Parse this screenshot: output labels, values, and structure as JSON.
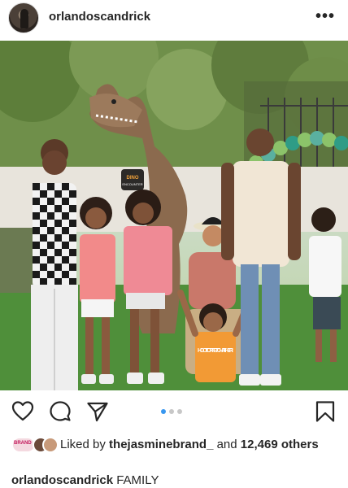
{
  "post": {
    "username": "orlandoscandrick",
    "more_icon": "ellipsis-icon",
    "photo_alt": "",
    "sign_text_1": "DINO",
    "sign_text_2": "ENCOUNTER",
    "shirt_text": "HOOT OR FETCH ATHER!"
  },
  "actions": {
    "like_icon": "heart-icon",
    "comment_icon": "comment-icon",
    "share_icon": "paper-plane-icon",
    "save_icon": "bookmark-icon"
  },
  "carousel": {
    "total": 3,
    "active": 1
  },
  "likes": {
    "prefix": "Liked by",
    "user": "thejasminebrand_",
    "connector": "and",
    "count": "12,469",
    "suffix": "others",
    "badge_text": "BRAND"
  },
  "caption": {
    "username": "orlandoscandrick",
    "text": "FAMILY"
  },
  "colors": {
    "text": "#262626",
    "active_dot": "#3897f0",
    "inactive_dot": "#c7c7c7"
  }
}
